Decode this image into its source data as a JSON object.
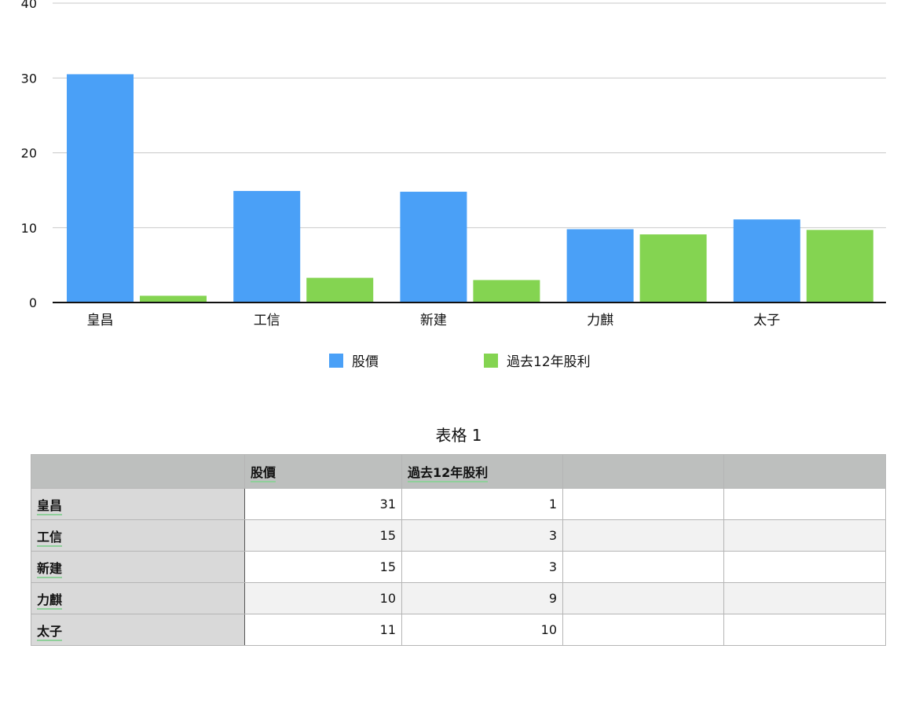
{
  "chart_data": {
    "type": "bar",
    "categories": [
      "皇昌",
      "工信",
      "新建",
      "力麒",
      "太子"
    ],
    "series": [
      {
        "name": "股價",
        "values": [
          30.5,
          14.9,
          14.8,
          9.8,
          11.1
        ],
        "color": "#4aa0f7"
      },
      {
        "name": "過去12年股利",
        "values": [
          0.9,
          3.3,
          3.0,
          9.1,
          9.7
        ],
        "color": "#84d451"
      }
    ],
    "yticks": [
      0,
      10,
      20,
      30,
      40
    ],
    "ylim": [
      0,
      40
    ],
    "grid": true,
    "legend_position": "bottom"
  },
  "table": {
    "title": "表格 1",
    "headers": [
      "",
      "股價",
      "過去12年股利",
      "",
      ""
    ],
    "rows": [
      {
        "label": "皇昌",
        "c1": "31",
        "c2": "1"
      },
      {
        "label": "工信",
        "c1": "15",
        "c2": "3"
      },
      {
        "label": "新建",
        "c1": "15",
        "c2": "3"
      },
      {
        "label": "力麒",
        "c1": "10",
        "c2": "9"
      },
      {
        "label": "太子",
        "c1": "11",
        "c2": "10"
      }
    ]
  }
}
